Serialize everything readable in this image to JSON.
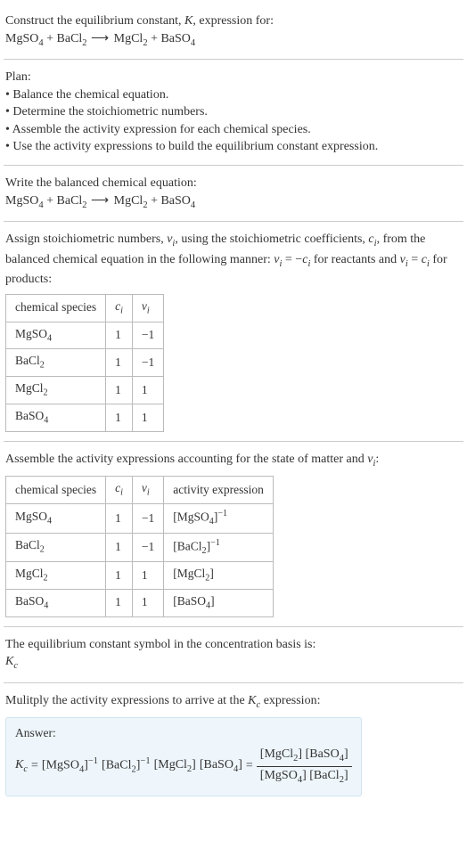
{
  "intro": {
    "line1": "Construct the equilibrium constant, ",
    "Ksym": "K",
    "line1b": ", expression for:",
    "equation_lhs1": "MgSO",
    "equation_lhs1_sub": "4",
    "plus": " + ",
    "equation_lhs2": "BaCl",
    "equation_lhs2_sub": "2",
    "arrow": " ⟶ ",
    "equation_rhs1": "MgCl",
    "equation_rhs1_sub": "2",
    "equation_rhs2": "BaSO",
    "equation_rhs2_sub": "4"
  },
  "plan": {
    "title": "Plan:",
    "b1": "• Balance the chemical equation.",
    "b2": "• Determine the stoichiometric numbers.",
    "b3": "• Assemble the activity expression for each chemical species.",
    "b4": "• Use the activity expressions to build the equilibrium constant expression."
  },
  "balanced": {
    "title": "Write the balanced chemical equation:"
  },
  "stoich_text": {
    "p1": "Assign stoichiometric numbers, ",
    "nu_i": "ν",
    "sub_i": "i",
    "p2": ", using the stoichiometric coefficients, ",
    "c_i": "c",
    "p3": ", from the balanced chemical equation in the following manner: ",
    "eq1a": "ν",
    "eq1b": " = −",
    "eq1c": "c",
    "p4": " for reactants and ",
    "eq2a": "ν",
    "eq2b": " = ",
    "eq2c": "c",
    "p5": " for products:"
  },
  "table1": {
    "h1": "chemical species",
    "h2": "c",
    "h2sub": "i",
    "h3": "ν",
    "h3sub": "i",
    "rows": [
      {
        "sp": "MgSO",
        "sub": "4",
        "c": "1",
        "v": "−1"
      },
      {
        "sp": "BaCl",
        "sub": "2",
        "c": "1",
        "v": "−1"
      },
      {
        "sp": "MgCl",
        "sub": "2",
        "c": "1",
        "v": "1"
      },
      {
        "sp": "BaSO",
        "sub": "4",
        "c": "1",
        "v": "1"
      }
    ]
  },
  "activity_text": {
    "p1": "Assemble the activity expressions accounting for the state of matter and ",
    "nu": "ν",
    "sub_i": "i",
    "p2": ":"
  },
  "table2": {
    "h1": "chemical species",
    "h2": "c",
    "h2sub": "i",
    "h3": "ν",
    "h3sub": "i",
    "h4": "activity expression",
    "rows": [
      {
        "sp": "MgSO",
        "sub": "4",
        "c": "1",
        "v": "−1",
        "exp": "[MgSO",
        "expsub": "4",
        "pow": "−1"
      },
      {
        "sp": "BaCl",
        "sub": "2",
        "c": "1",
        "v": "−1",
        "exp": "[BaCl",
        "expsub": "2",
        "pow": "−1"
      },
      {
        "sp": "MgCl",
        "sub": "2",
        "c": "1",
        "v": "1",
        "exp": "[MgCl",
        "expsub": "2",
        "pow": ""
      },
      {
        "sp": "BaSO",
        "sub": "4",
        "c": "1",
        "v": "1",
        "exp": "[BaSO",
        "expsub": "4",
        "pow": ""
      }
    ]
  },
  "kc_text": {
    "p1": "The equilibrium constant symbol in the concentration basis is:",
    "K": "K",
    "Ksub": "c"
  },
  "mult_text": "Mulitply the activity expressions to arrive at the ",
  "mult_K": "K",
  "mult_Ksub": "c",
  "mult_text2": " expression:",
  "answer": {
    "label": "Answer:",
    "K": "K",
    "Ksub": "c",
    "eq": " = ",
    "t1": "[MgSO",
    "t1s": "4",
    "p1": "−1",
    "t2": "[BaCl",
    "t2s": "2",
    "p2": "−1",
    "t3": "[MgCl",
    "t3s": "2",
    "t4": "[BaSO",
    "t4s": "4",
    "eq2": " = ",
    "num1": "[MgCl",
    "num1s": "2",
    "num2": "[BaSO",
    "num2s": "4",
    "den1": "[MgSO",
    "den1s": "4",
    "den2": "[BaCl",
    "den2s": "2"
  }
}
